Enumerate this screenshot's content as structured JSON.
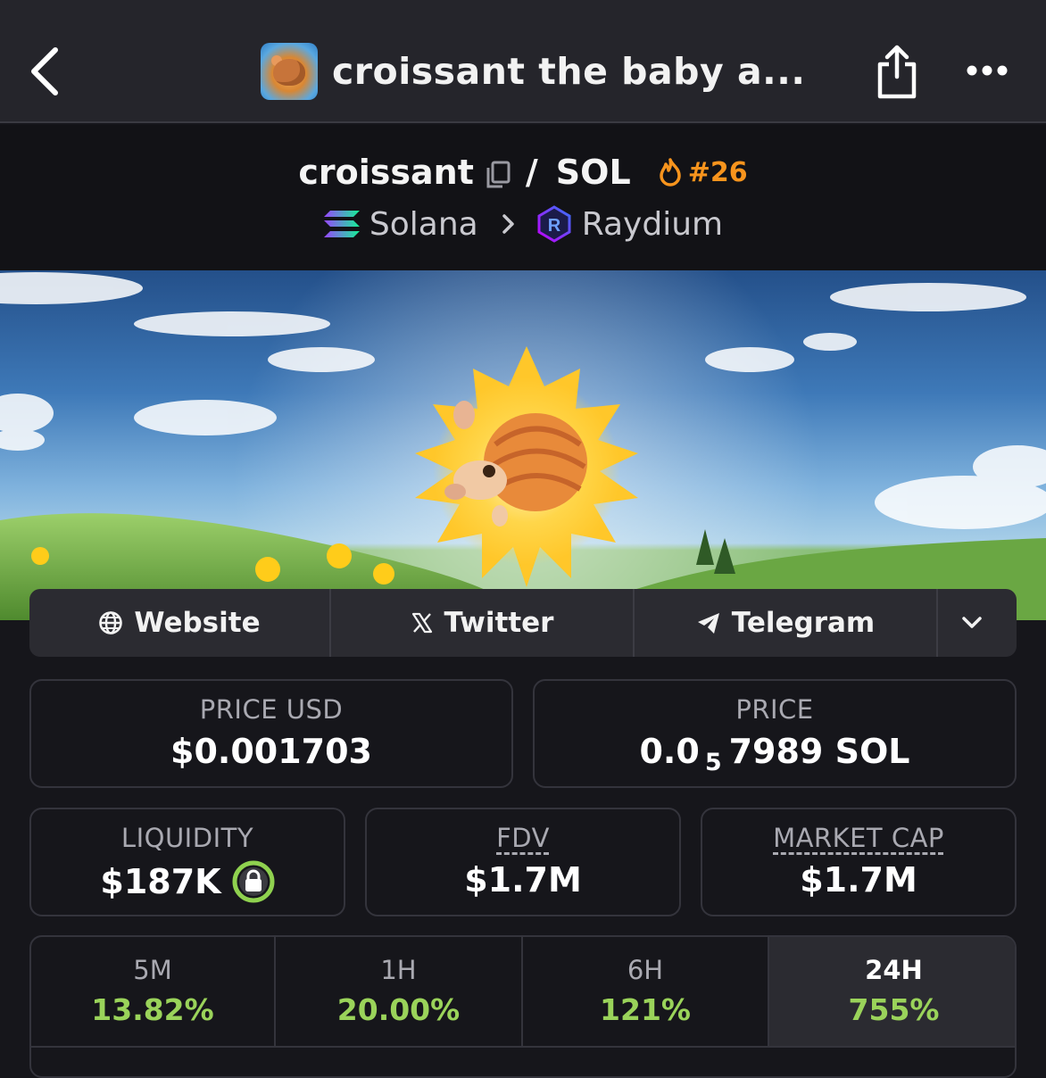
{
  "nav": {
    "title": "croissant the baby a...",
    "back_icon": "chevron-left-icon",
    "share_icon": "share-icon",
    "more_icon": "more-horizontal-icon"
  },
  "pair": {
    "base": "croissant",
    "quote": "SOL",
    "rank": "#26",
    "chain": "Solana",
    "dex": "Raydium"
  },
  "socials": [
    {
      "label": "Website",
      "icon": "globe-icon"
    },
    {
      "label": "Twitter",
      "icon": "x-logo-icon"
    },
    {
      "label": "Telegram",
      "icon": "telegram-icon"
    }
  ],
  "stats": {
    "price_usd": {
      "label": "PRICE USD",
      "value": "$0.001703"
    },
    "price": {
      "label": "PRICE",
      "prefix": "0.0",
      "sub": "5",
      "suffix": "7989 SOL"
    },
    "liquidity": {
      "label": "LIQUIDITY",
      "value": "$187K"
    },
    "fdv": {
      "label": "FDV",
      "value": "$1.7M"
    },
    "market_cap": {
      "label": "MARKET CAP",
      "value": "$1.7M"
    }
  },
  "timeframes": [
    {
      "label": "5M",
      "value": "13.82%"
    },
    {
      "label": "1H",
      "value": "20.00%"
    },
    {
      "label": "6H",
      "value": "121%"
    },
    {
      "label": "24H",
      "value": "755%",
      "active": true
    }
  ],
  "colors": {
    "accent_orange": "#f7941d",
    "positive_green": "#9ad35a",
    "lock_green": "#8fd14f"
  }
}
